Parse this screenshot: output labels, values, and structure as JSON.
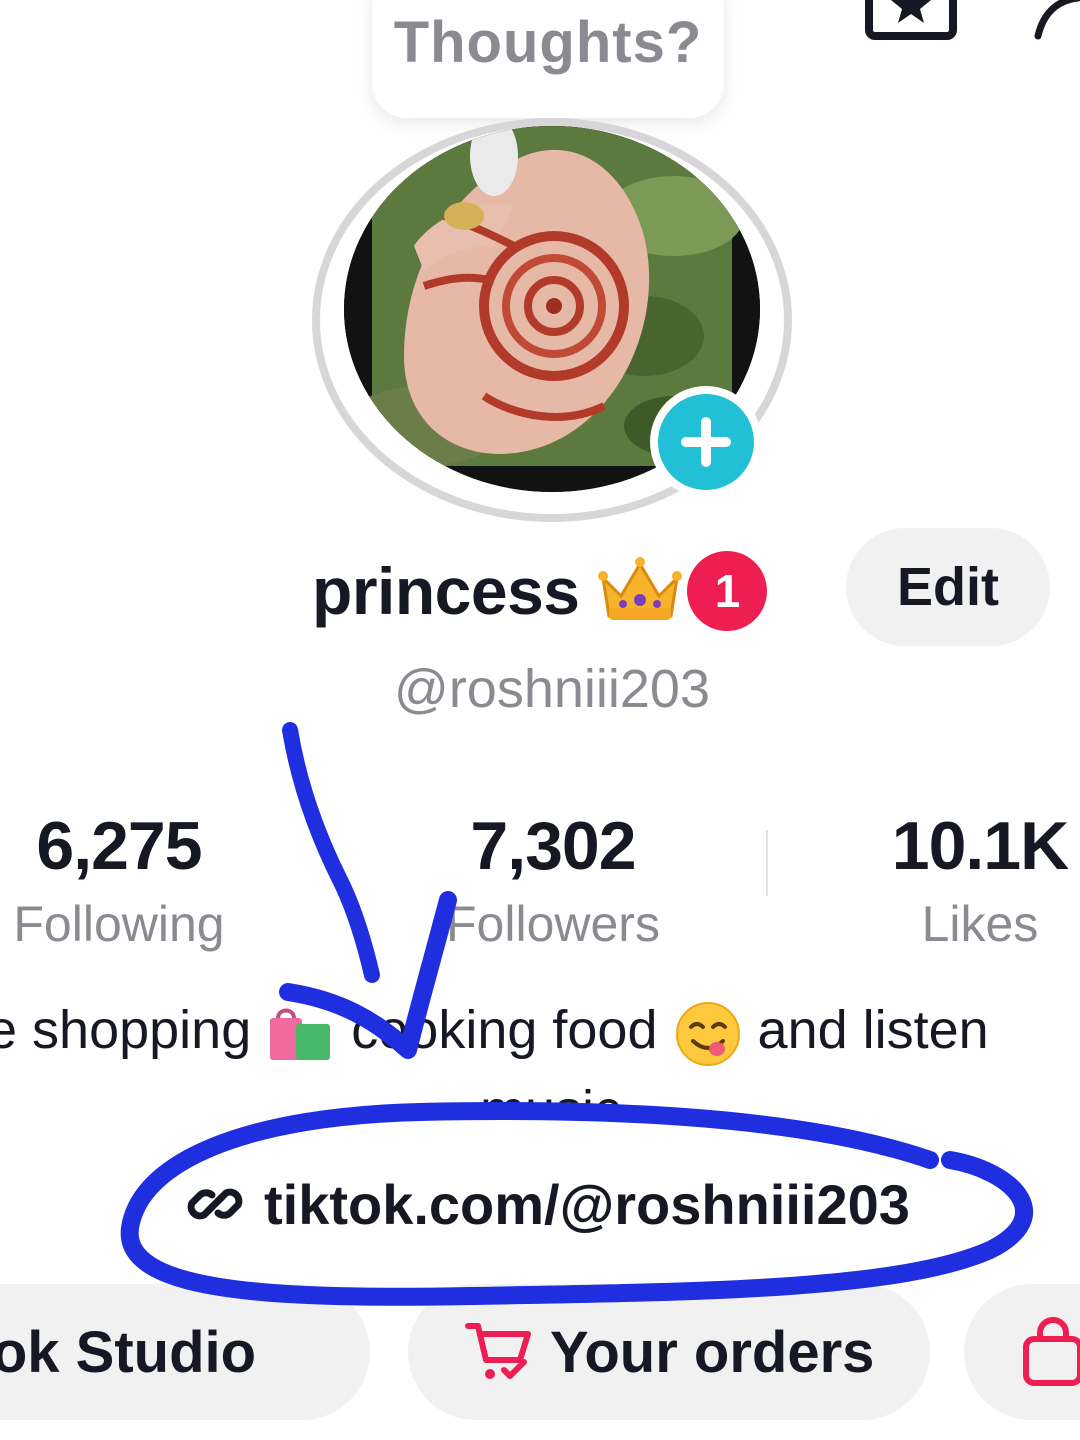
{
  "thoughts": {
    "text": "Thoughts?"
  },
  "top_icons": {
    "favorites": "favorites-icon",
    "share": "share-icon"
  },
  "profile": {
    "display_name": "princess",
    "name_emoji": "crown",
    "notification_count": "1",
    "edit_label": "Edit",
    "username": "@roshniii203"
  },
  "stats": [
    {
      "value": "6,275",
      "label": "Following"
    },
    {
      "value": "7,302",
      "label": "Followers"
    },
    {
      "value": "10.1K",
      "label": "Likes"
    }
  ],
  "bio": {
    "part1": "ve shopping",
    "part2": "cooking food",
    "part3": "and listen",
    "line2": "music"
  },
  "link": {
    "url": "tiktok.com/@roshniii203",
    "icon": "link-icon"
  },
  "actions": [
    {
      "label": "TikTok Studio"
    },
    {
      "label": "Your orders",
      "icon": "cart-icon"
    },
    {
      "label": "",
      "icon": "shopping-bag-icon"
    }
  ],
  "colors": {
    "accent_red": "#ee1d52",
    "add_button": "#21c0d6",
    "annotation_blue": "#1f2fe0",
    "secondary_text": "#8a8b91",
    "pill_bg": "#f1f1f2"
  }
}
